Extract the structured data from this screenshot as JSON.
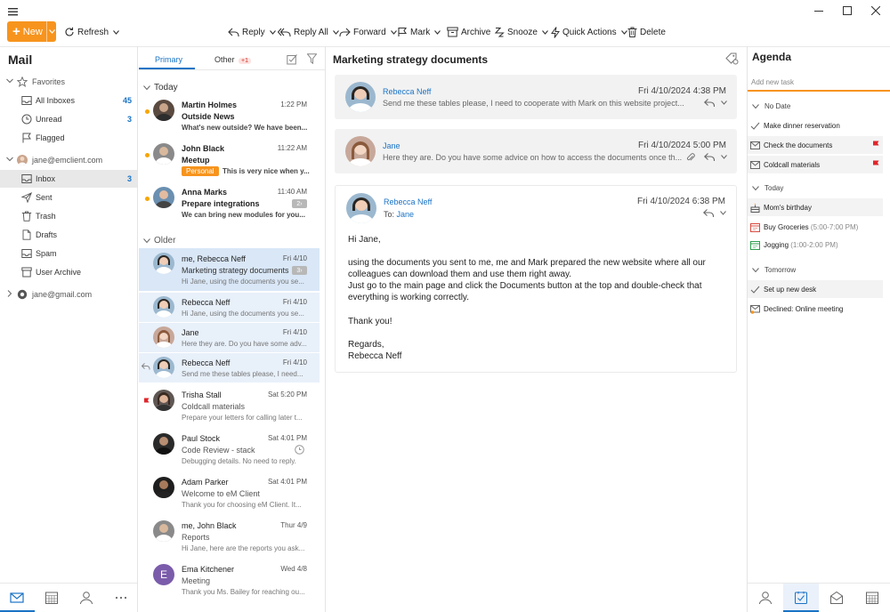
{
  "toolbar": {
    "new_label": "New",
    "refresh_label": "Refresh",
    "reply_label": "Reply",
    "reply_all_label": "Reply All",
    "forward_label": "Forward",
    "mark_label": "Mark",
    "archive_label": "Archive",
    "snooze_label": "Snooze",
    "quick_actions_label": "Quick Actions",
    "delete_label": "Delete"
  },
  "colors": {
    "accent": "#f7941d",
    "link": "#1a73c6",
    "flag": "#e0262b"
  },
  "sidebar": {
    "title": "Mail",
    "favorites_label": "Favorites",
    "favorites": [
      {
        "label": "All Inboxes",
        "count": "45"
      },
      {
        "label": "Unread",
        "count": "3"
      },
      {
        "label": "Flagged",
        "count": ""
      }
    ],
    "account1": "jane@emclient.com",
    "folders": [
      {
        "label": "Inbox",
        "count": "3"
      },
      {
        "label": "Sent",
        "count": ""
      },
      {
        "label": "Trash",
        "count": ""
      },
      {
        "label": "Drafts",
        "count": ""
      },
      {
        "label": "Spam",
        "count": ""
      },
      {
        "label": "User Archive",
        "count": ""
      }
    ],
    "account2": "jane@gmail.com"
  },
  "list": {
    "tab_primary": "Primary",
    "tab_other": "Other",
    "other_badge": "+1",
    "group_today": "Today",
    "group_older": "Older",
    "messages": [
      {
        "from": "Martin Holmes",
        "date": "1:22 PM",
        "subject": "Outside News",
        "preview": "What's new outside? We have been..."
      },
      {
        "from": "John Black",
        "date": "11:22 AM",
        "subject": "Meetup",
        "tag": "Personal",
        "preview": "This is very nice when y..."
      },
      {
        "from": "Anna Marks",
        "date": "11:40 AM",
        "subject": "Prepare integrations",
        "count": "2",
        "preview": "We can bring new modules for you..."
      },
      {
        "from": "me, Rebecca Neff",
        "date": "Fri 4/10",
        "subject": "Marketing strategy documents",
        "count": "3",
        "preview": "Hi Jane, using the documents you se..."
      },
      {
        "from": "Rebecca Neff",
        "date": "Fri 4/10",
        "preview": "Hi Jane, using the documents you se..."
      },
      {
        "from": "Jane",
        "date": "Fri 4/10",
        "preview": "Here they are. Do you have some adv..."
      },
      {
        "from": "Rebecca Neff",
        "date": "Fri 4/10",
        "preview": "Send me these tables please, I need..."
      },
      {
        "from": "Trisha Stall",
        "date": "Sat 5:20 PM",
        "subject": "Coldcall materials",
        "preview": "Prepare your letters for calling later t..."
      },
      {
        "from": "Paul Stock",
        "date": "Sat 4:01 PM",
        "subject": "Code Review - stack",
        "preview": "Debugging details. No need to reply."
      },
      {
        "from": "Adam Parker",
        "date": "Sat 4:01 PM",
        "subject": "Welcome to eM Client",
        "preview": "Thank you for choosing eM Client. It..."
      },
      {
        "from": "me, John Black",
        "date": "Thur 4/9",
        "subject": "Reports",
        "preview": "Hi Jane, here are the reports you ask..."
      },
      {
        "from": "Ema Kitchener",
        "date": "Wed 4/8",
        "subject": "Meeting",
        "initial": "E",
        "preview": "Thank you Ms. Bailey for reaching ou..."
      }
    ]
  },
  "reading": {
    "title": "Marketing strategy documents",
    "cards": [
      {
        "sender": "Rebecca Neff",
        "date": "Fri 4/10/2024 4:38 PM",
        "snippet": "Send me these tables please, I need to cooperate with Mark on this website project..."
      },
      {
        "sender": "Jane",
        "date": "Fri 4/10/2024 5:00 PM",
        "snippet": "Here they are. Do you have some advice on how to access the documents once th..."
      }
    ],
    "open": {
      "sender": "Rebecca Neff",
      "date": "Fri 4/10/2024 6:38 PM",
      "to_label": "To:",
      "to": "Jane",
      "greeting": "Hi Jane,",
      "para1": "using the documents you sent to me, me and Mark prepared the new website where all our colleagues can download them and use them right away.",
      "para2": "Just go to the main page and click the Documents button at the top and double-check that everything is working correctly.",
      "thanks": "Thank you!",
      "regards": "Regards,",
      "signature": "Rebecca Neff"
    }
  },
  "agenda": {
    "title": "Agenda",
    "add_placeholder": "Add new task",
    "group_nodate": "No Date",
    "group_today": "Today",
    "group_tomorrow": "Tomorrow",
    "nodate": [
      "Make dinner reservation",
      "Check the documents",
      "Coldcall materials"
    ],
    "today": [
      {
        "label": "Mom's birthday",
        "time": ""
      },
      {
        "label": "Buy Groceries",
        "time": "(5:00-7:00 PM)"
      },
      {
        "label": "Jogging",
        "time": "(1:00-2:00 PM)"
      }
    ],
    "tomorrow": [
      "Set up new desk",
      "Declined: Online meeting"
    ]
  }
}
